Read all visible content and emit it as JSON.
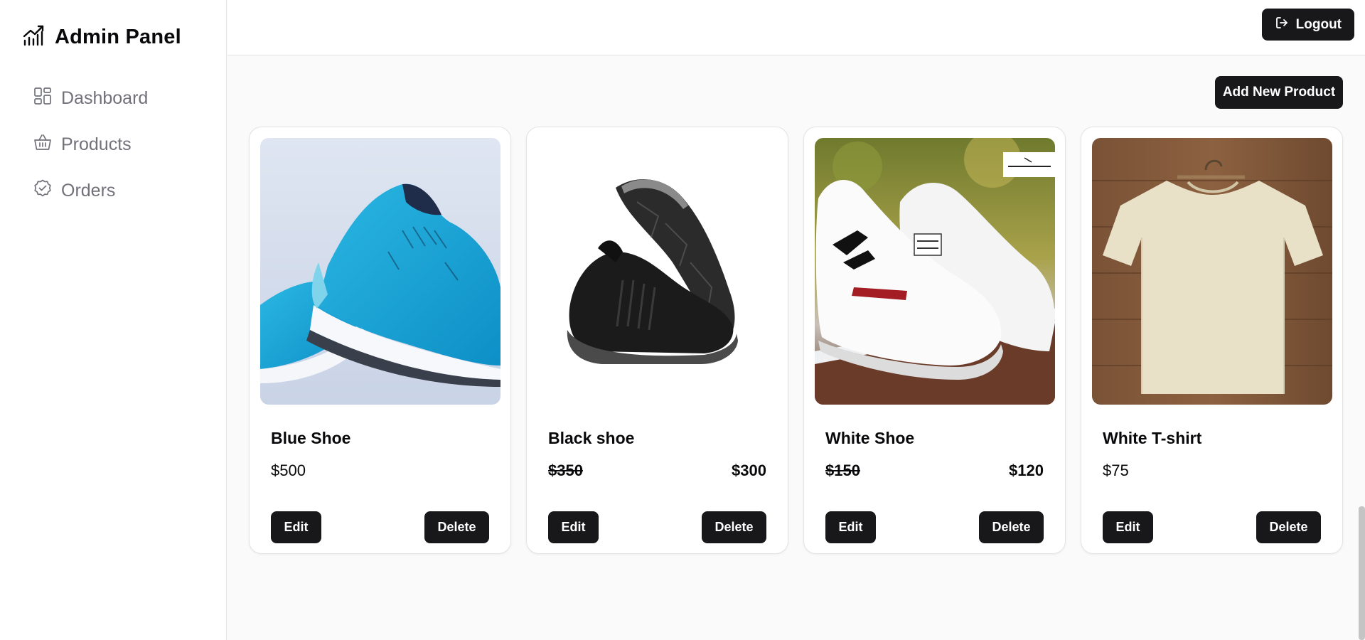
{
  "brand": {
    "title": "Admin Panel",
    "icon": "chart-line-icon"
  },
  "nav": [
    {
      "label": "Dashboard",
      "icon": "layout-grid-icon"
    },
    {
      "label": "Products",
      "icon": "shopping-basket-icon"
    },
    {
      "label": "Orders",
      "icon": "badge-check-icon"
    }
  ],
  "header": {
    "logout_label": "Logout",
    "logout_icon": "log-out-icon"
  },
  "actions": {
    "add_product_label": "Add New Product"
  },
  "products": [
    {
      "name": "Blue Shoe",
      "price": "$500",
      "edit_label": "Edit",
      "delete_label": "Delete"
    },
    {
      "name": "Black shoe",
      "old_price": "$350",
      "sale_price": "$300",
      "edit_label": "Edit",
      "delete_label": "Delete"
    },
    {
      "name": "White Shoe",
      "old_price": "$150",
      "sale_price": "$120",
      "edit_label": "Edit",
      "delete_label": "Delete"
    },
    {
      "name": "White T-shirt",
      "price": "$75",
      "edit_label": "Edit",
      "delete_label": "Delete"
    }
  ],
  "colors": {
    "primary_button": "#18181b",
    "sidebar_text": "#71717a",
    "page_bg": "#fafafa"
  }
}
